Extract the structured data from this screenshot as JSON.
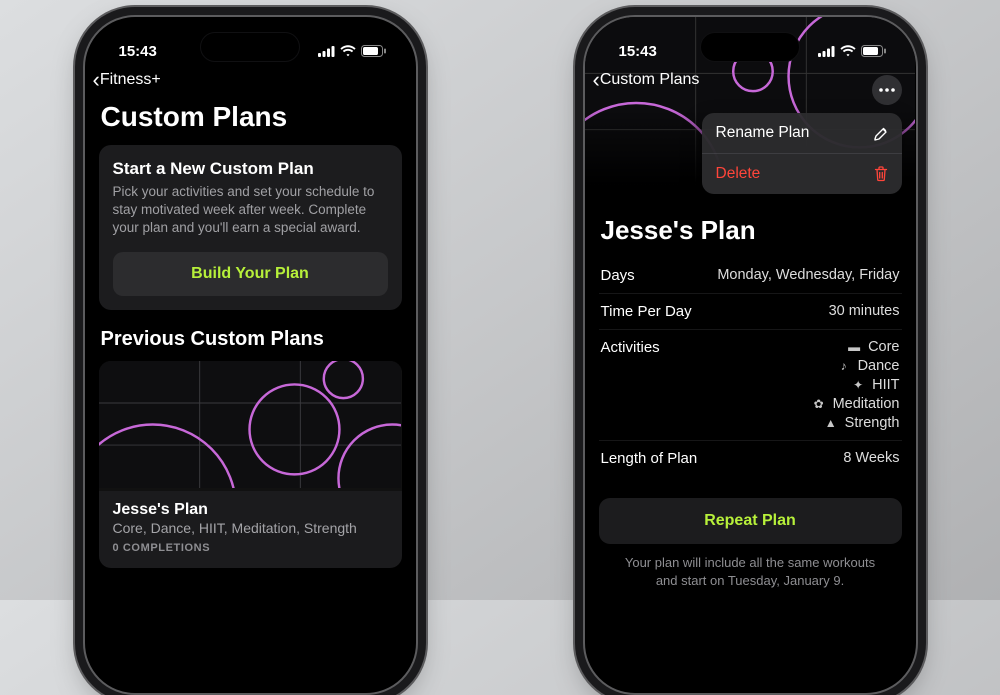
{
  "status": {
    "time": "15:43"
  },
  "left": {
    "back_label": "Fitness+",
    "title": "Custom Plans",
    "new_card": {
      "heading": "Start a New Custom Plan",
      "body": "Pick your activities and set your schedule to stay motivated week after week. Complete your plan and you'll earn a special award.",
      "button": "Build Your Plan"
    },
    "previous_heading": "Previous Custom Plans",
    "previous_plan": {
      "name": "Jesse's Plan",
      "subtitle": "Core, Dance, HIIT, Meditation, Strength",
      "completions": "0 COMPLETIONS"
    }
  },
  "right": {
    "back_label": "Custom Plans",
    "menu": {
      "rename": "Rename Plan",
      "delete": "Delete"
    },
    "plan_title": "Jesse's Plan",
    "rows": {
      "days_k": "Days",
      "days_v": "Monday, Wednesday, Friday",
      "time_k": "Time Per Day",
      "time_v": "30 minutes",
      "acts_k": "Activities",
      "acts": [
        "Core",
        "Dance",
        "HIIT",
        "Meditation",
        "Strength"
      ],
      "len_k": "Length of Plan",
      "len_v": "8 Weeks"
    },
    "repeat_label": "Repeat Plan",
    "repeat_note": "Your plan will include all the same workouts and start on Tuesday, January 9."
  }
}
